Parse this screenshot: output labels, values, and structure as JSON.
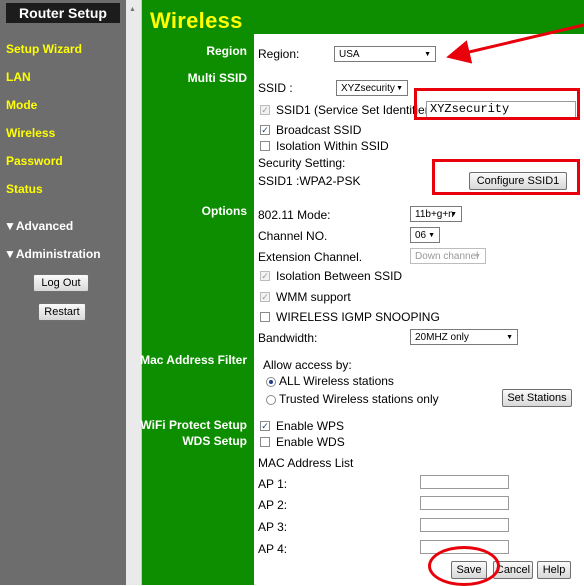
{
  "sidebar": {
    "title": "Router Setup",
    "items": [
      {
        "label": "Setup Wizard"
      },
      {
        "label": "LAN"
      },
      {
        "label": "Mode"
      },
      {
        "label": "Wireless"
      },
      {
        "label": "Password"
      },
      {
        "label": "Status"
      }
    ],
    "advanced": "▼Advanced",
    "administration": "▼Administration",
    "logout": "Log Out",
    "restart": "Restart"
  },
  "page_title": "Wireless",
  "sections": {
    "region": "Region",
    "multi_ssid": "Multi SSID",
    "options": "Options",
    "mac_filter": "Mac Address Filter",
    "wps": "WiFi Protect Setup",
    "wds": "WDS Setup"
  },
  "region": {
    "label": "Region:",
    "value": "USA"
  },
  "ssid": {
    "label": "SSID :",
    "value": "XYZsecurity",
    "ssid1_label": "SSID1 (Service Set Identifier)",
    "ssid1_value": "XYZsecurity",
    "broadcast": "Broadcast SSID",
    "isolation": "Isolation Within SSID",
    "security_setting": "Security Setting:",
    "security_value": "SSID1 :WPA2-PSK",
    "configure_btn": "Configure SSID1"
  },
  "options": {
    "mode_label": "802.11 Mode:",
    "mode_value": "11b+g+n",
    "channel_label": "Channel NO.",
    "channel_value": "06",
    "ext_label": "Extension Channel.",
    "ext_value": "Down channel",
    "isolation_between": "Isolation Between SSID",
    "wmm": "WMM support",
    "igmp": "WIRELESS IGMP SNOOPING",
    "bandwidth_label": "Bandwidth:",
    "bandwidth_value": "20MHZ only"
  },
  "mac_filter": {
    "allow_label": "Allow access by:",
    "all_stations": "ALL Wireless stations",
    "trusted_stations": "Trusted Wireless stations only",
    "set_stations_btn": "Set Stations"
  },
  "wps": {
    "enable_wps": "Enable WPS"
  },
  "wds": {
    "enable_wds": "Enable WDS",
    "mac_list": "MAC Address List",
    "ap1": "AP 1:",
    "ap2": "AP 2:",
    "ap3": "AP 3:",
    "ap4": "AP 4:"
  },
  "footer": {
    "save": "Save",
    "cancel": "Cancel",
    "help": "Help"
  },
  "colors": {
    "sidebar": "#6d6d6d",
    "green": "#0c8e00",
    "nav_text": "#ffff00",
    "annotation": "#e8000b"
  },
  "icons": {
    "dropdown": "triangle-down",
    "checkbox": "check-mark"
  }
}
